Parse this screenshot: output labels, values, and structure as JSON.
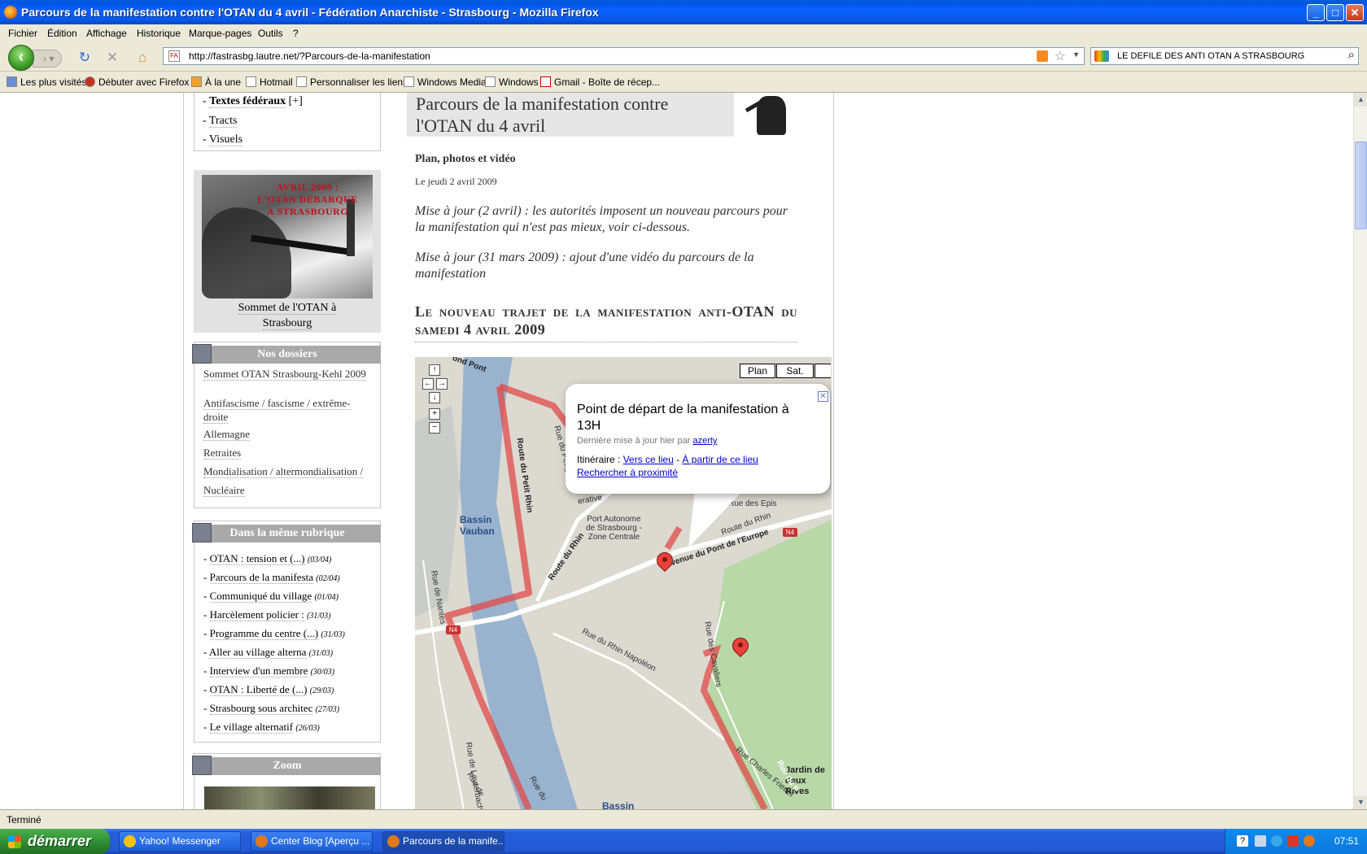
{
  "window": {
    "title": "Parcours de la manifestation contre l'OTAN du 4 avril - Fédération Anarchiste - Strasbourg - Mozilla Firefox"
  },
  "menu": [
    "Fichier",
    "Édition",
    "Affichage",
    "Historique",
    "Marque-pages",
    "Outils",
    "?"
  ],
  "nav": {
    "url": "http://fastrasbg.lautre.net/?Parcours-de-la-manifestation",
    "search_value": "LE DEFILE DES ANTI OTAN A STRASBOURG"
  },
  "bookmarks": [
    "Les plus visités",
    "Débuter avec Firefox",
    "À la une",
    "Hotmail",
    "Personnaliser les liens",
    "Windows Media",
    "Windows",
    "Gmail - Boîte de récep..."
  ],
  "sidebar": {
    "nav": [
      {
        "prefix": "- ",
        "label": "Textes fédéraux",
        "suffix": " [+]"
      },
      {
        "prefix": "- ",
        "label": "Tracts",
        "suffix": ""
      },
      {
        "prefix": "- ",
        "label": "Visuels",
        "suffix": ""
      }
    ],
    "promo": {
      "image_text_1": "AVRIL 2009 :",
      "image_text_2": "L'OTAN DÉBARQUE",
      "image_text_3": "À STRASBOURG",
      "caption_1": "Sommet de l'OTAN à",
      "caption_2": "Strasbourg"
    },
    "dossiers": {
      "heading": "Nos dossiers",
      "items": [
        "Sommet OTAN Strasbourg-Kehl 2009",
        "Antifascisme / fascisme / extrême-droite",
        "Allemagne",
        "Retraites",
        "Mondialisation / altermondialisation /",
        "Nucléaire"
      ]
    },
    "rubrique": {
      "heading": "Dans la même rubrique",
      "items": [
        {
          "label": "OTAN : tension et (...)",
          "date": "(03/04)"
        },
        {
          "label": "Parcours de la manifesta",
          "date": "(02/04)"
        },
        {
          "label": "Communiqué du village",
          "date": "(01/04)"
        },
        {
          "label": "Harcèlement policier :",
          "date": "(31/03)"
        },
        {
          "label": "Programme du centre (...)",
          "date": "(31/03)"
        },
        {
          "label": "Aller au village alterna",
          "date": "(31/03)"
        },
        {
          "label": "Interview d'un membre",
          "date": "(30/03)"
        },
        {
          "label": "OTAN : Liberté de (...)",
          "date": "(29/03)"
        },
        {
          "label": "Strasbourg sous architec",
          "date": "(27/03)"
        },
        {
          "label": "Le village alternatif",
          "date": "(26/03)"
        }
      ]
    },
    "zoom": {
      "heading": "Zoom"
    }
  },
  "article": {
    "title_1": "Parcours de la manifestation contre",
    "title_2": "l'OTAN du 4 avril",
    "subtitle": "Plan, photos et vidéo",
    "date": "Le jeudi 2 avril 2009",
    "update_1": "Mise à jour (2 avril) : les autorités imposent un nouveau parcours pour la manifestation qui n'est pas mieux, voir ci-dessous.",
    "update_2": "Mise à jour (31 mars 2009) : ajout d'une vidéo du parcours de la manifestation",
    "heading": "Le nouveau trajet de la manifestation anti-OTAN du samedi 4 avril 2009"
  },
  "map": {
    "buttons": [
      "Plan",
      "Sat."
    ],
    "info": {
      "title": "Point de départ de la manifestation à 13H",
      "meta_prefix": "Dernière mise à jour hier par ",
      "meta_user": "azerty",
      "itinerary_label": "Itinéraire : ",
      "to_here": "Vers ce lieu",
      "sep": " - ",
      "from_here": "À partir de ce lieu",
      "nearby": "Rechercher à proximité"
    },
    "labels": {
      "bassin_vauban_1": "Bassin",
      "bassin_vauban_2": "Vauban",
      "port_1": "Port Autonome",
      "port_2": "de Strasbourg -",
      "port_3": "Zone Centrale",
      "route_petit_rhin": "Route du Petit Rhin",
      "route_rhin": "Route du Rhin",
      "avenue_pont_europe": "Avenue du Pont de l'Europe",
      "rue_peage": "Rue du Péage",
      "rue_nantes": "Rue de Nantes",
      "rue_rhin_napoleon": "Rue du Rhin Napoléon",
      "rue_cavaliers": "Rue des Cavaliers",
      "route_du_rhin_2": "Route du Rhin",
      "rue_epis": "Rue des Epis",
      "rue_charles_friedel": "Rue Charles Friedel",
      "jardin_1": "Jardin de",
      "jardin_2": "deux Rives",
      "bassin_bottom": "Bassin",
      "pont": "ond Pont",
      "rue_lauterbach": "Rue de Lauterbach",
      "rue_du_bottom": "Rue du",
      "rue_de_bottom": "Rue de",
      "erative": "erative",
      "n4": "N4",
      "rue_du_pea_right": "Rue du P"
    }
  },
  "status": "Terminé",
  "taskbar": {
    "start": "démarrer",
    "tasks": [
      "Yahoo! Messenger",
      "Center Blog [Aperçu ...",
      "Parcours de la manife..."
    ],
    "clock": "07:51"
  },
  "colors": {
    "route_red": "#e24a4a",
    "sidebar_heading_bg": "#a9a9a9",
    "link_blue": "#0000cc"
  }
}
